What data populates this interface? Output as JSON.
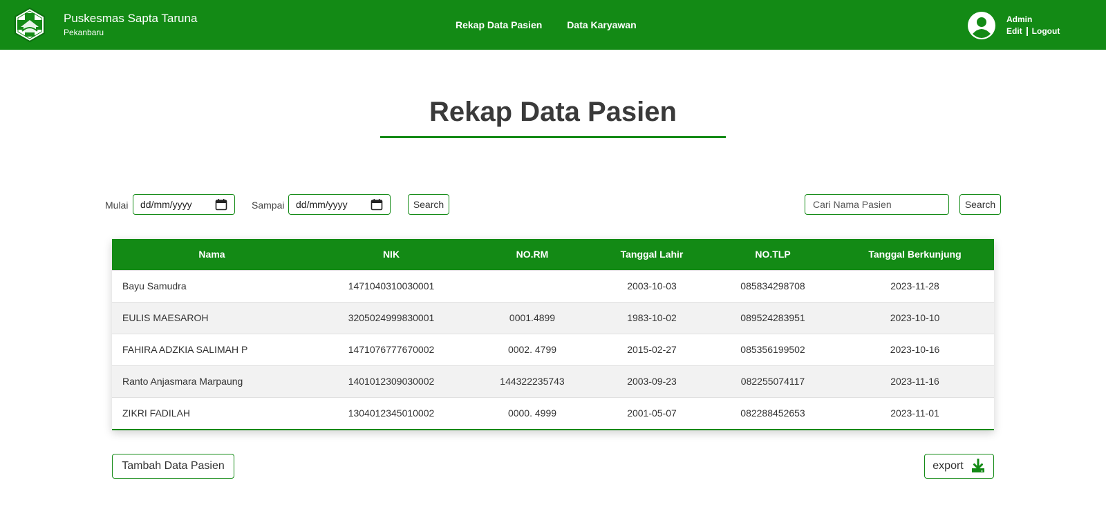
{
  "header": {
    "brand_title": "Puskesmas Sapta Taruna",
    "brand_subtitle": "Pekanbaru",
    "nav": [
      "Rekap Data Pasien",
      "Data Karyawan"
    ],
    "user_name": "Admin",
    "edit_label": "Edit",
    "logout_label": "Logout"
  },
  "page": {
    "title": "Rekap Data Pasien"
  },
  "filters": {
    "start_label": "Mulai",
    "start_value": "dd/mm/yyyy",
    "end_label": "Sampai",
    "end_value": "dd/mm/yyyy",
    "date_search_label": "Search",
    "name_placeholder": "Cari Nama Pasien",
    "name_search_label": "Search"
  },
  "table": {
    "columns": [
      "Nama",
      "NIK",
      "NO.RM",
      "Tanggal Lahir",
      "NO.TLP",
      "Tanggal Berkunjung"
    ],
    "rows": [
      [
        "Bayu Samudra",
        "1471040310030001",
        "",
        "2003-10-03",
        "085834298708",
        "2023-11-28"
      ],
      [
        "EULIS MAESAROH",
        "3205024999830001",
        "0001.4899",
        "1983-10-02",
        "089524283951",
        "2023-10-10"
      ],
      [
        "FAHIRA ADZKIA SALIMAH P",
        "1471076777670002",
        "0002. 4799",
        "2015-02-27",
        "085356199502",
        "2023-10-16"
      ],
      [
        "Ranto Anjasmara Marpaung",
        "1401012309030002",
        "144322235743",
        "2003-09-23",
        "082255074117",
        "2023-11-16"
      ],
      [
        "ZIKRI FADILAH",
        "1304012345010002",
        "0000. 4999",
        "2001-05-07",
        "082288452653",
        "2023-11-01"
      ]
    ]
  },
  "actions": {
    "add_label": "Tambah Data Pasien",
    "export_label": "export"
  },
  "colors": {
    "brand_green": "#138a15",
    "row_alt": "#f2f2f2"
  },
  "icons": {
    "logo": "health-cross-logo-icon",
    "avatar": "user-avatar-icon",
    "calendar": "calendar-icon",
    "download": "download-icon"
  }
}
